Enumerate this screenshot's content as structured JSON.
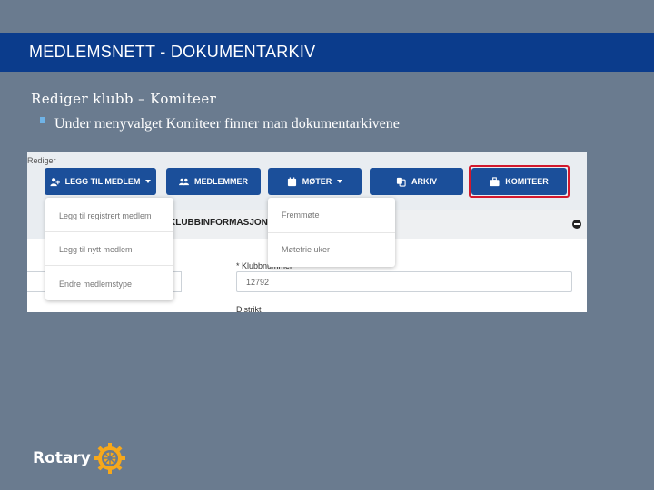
{
  "slide": {
    "title": "MEDLEMSNETT - DOKUMENTARKIV",
    "subtitle": "Rediger klubb – Komiteer",
    "bullet": "Under menyvalget Komiteer finner man dokumentarkivene"
  },
  "screenshot": {
    "breadcrumb": "Rediger",
    "toolbar": {
      "add_member": "LEGG TIL MEDLEM",
      "members": "MEDLEMMER",
      "meetings": "MØTER",
      "archive": "ARKIV",
      "committee": "KOMITEER"
    },
    "add_member_menu": [
      "Legg til registrert medlem",
      "Legg til nytt medlem",
      "Endre medlemstype"
    ],
    "meetings_menu": [
      "Fremmøte",
      "Møtefrie uker"
    ],
    "section_title": "KLUBBINFORMASJON",
    "club_number_label": "* Klubbnummer",
    "club_number_value": "12792",
    "district_label": "Distrikt"
  },
  "logo": {
    "text": "Rotary"
  },
  "colors": {
    "background": "#6a7b8f",
    "title_bar": "#0b3c8c",
    "button": "#1b4f9a",
    "highlight": "#d3192d",
    "rotary_gold": "#f7a81b"
  }
}
